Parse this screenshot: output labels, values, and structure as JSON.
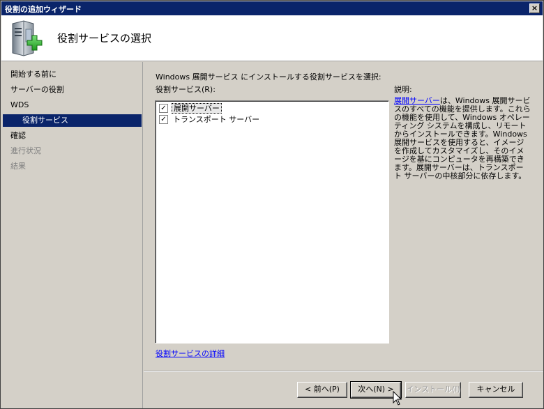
{
  "window": {
    "title": "役割の追加ウィザード",
    "close_label": "×"
  },
  "header": {
    "title": "役割サービスの選択",
    "icon": "server-add-icon"
  },
  "sidebar": {
    "items": [
      {
        "label": "開始する前に",
        "state": "normal"
      },
      {
        "label": "サーバーの役割",
        "state": "normal"
      },
      {
        "label": "WDS",
        "state": "normal"
      },
      {
        "label": "役割サービス",
        "state": "selected"
      },
      {
        "label": "確認",
        "state": "normal"
      },
      {
        "label": "進行状況",
        "state": "disabled"
      },
      {
        "label": "結果",
        "state": "disabled"
      }
    ]
  },
  "main": {
    "instruction": "Windows 展開サービス にインストールする役割サービスを選択:",
    "list_label": "役割サービス(R):",
    "services": [
      {
        "label": "展開サーバー",
        "checked": true,
        "check_glyph": "✓"
      },
      {
        "label": "トランスポート サーバー",
        "checked": true,
        "check_glyph": "✓"
      }
    ],
    "more_link": "役割サービスの詳細",
    "description_label": "説明:",
    "description_link": "展開サーバー",
    "description_text": "は、Windows 展開サービスのすべての機能を提供します。これらの機能を使用して、Windows オペレーティング システムを構成し、リモートからインストールできます。Windows 展開サービスを使用すると、イメージを作成してカスタマイズし、そのイメージを基にコンピュータを再構築できます。展開サーバーは、トランスポート サーバーの中核部分に依存します。"
  },
  "footer": {
    "back_label": "< 前へ(P)",
    "next_label": "次へ(N) >",
    "install_label": "インストール(I)",
    "cancel_label": "キャンセル"
  },
  "colors": {
    "titlebar": "#0a246a",
    "selection": "#0a246a",
    "link": "#0000ff",
    "face": "#d4d0c8"
  }
}
